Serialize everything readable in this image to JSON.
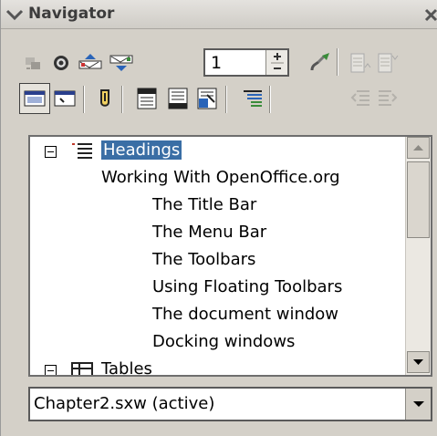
{
  "window": {
    "title": "Navigator"
  },
  "toolbar": {
    "row1": [
      {
        "icon": "toggle-icon",
        "state": "disabled"
      },
      {
        "icon": "navigation-icon"
      },
      {
        "icon": "previous-icon"
      },
      {
        "icon": "next-icon"
      },
      {
        "icon": "drag-mode-icon"
      },
      {
        "icon": "promote-level-icon",
        "state": "disabled"
      },
      {
        "icon": "demote-level-icon",
        "state": "disabled"
      }
    ],
    "row2": [
      {
        "icon": "content-view-icon",
        "state": "selected"
      },
      {
        "icon": "list-box-icon"
      },
      {
        "icon": "set-reminder-icon"
      },
      {
        "icon": "header-icon"
      },
      {
        "icon": "footer-icon"
      },
      {
        "icon": "anchor-text-icon"
      },
      {
        "icon": "heading-levels-icon"
      },
      {
        "icon": "promote-chapter-icon",
        "state": "disabled"
      },
      {
        "icon": "demote-chapter-icon",
        "state": "disabled"
      }
    ],
    "page_spin_value": "1"
  },
  "tree": {
    "items": [
      {
        "label": "Headings",
        "level": 0,
        "expander": "minus",
        "selected": true,
        "icon": "headings-icon"
      },
      {
        "label": "Working With OpenOffice.org",
        "level": 1
      },
      {
        "label": "The Title Bar",
        "level": 2
      },
      {
        "label": "The Menu Bar",
        "level": 2
      },
      {
        "label": "The Toolbars",
        "level": 2
      },
      {
        "label": "Using Floating Toolbars",
        "level": 2
      },
      {
        "label": "The document window",
        "level": 2
      },
      {
        "label": "Docking windows",
        "level": 2
      },
      {
        "label": "Tables",
        "level": 0,
        "expander": "minus",
        "icon": "tables-icon"
      }
    ]
  },
  "document_select": {
    "value": "Chapter2.sxw (active)"
  }
}
